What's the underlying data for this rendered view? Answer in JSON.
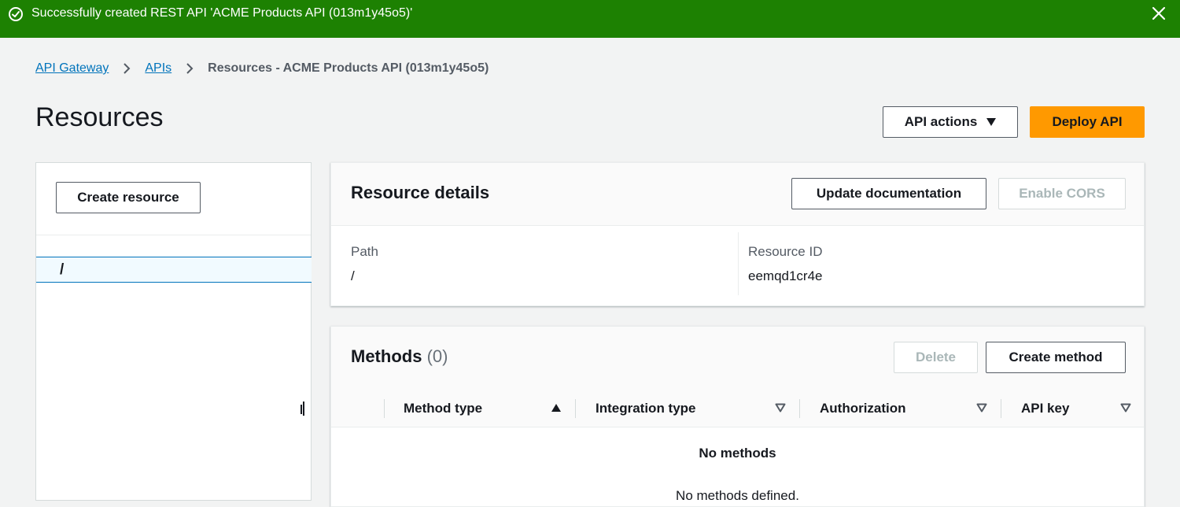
{
  "flash": {
    "message": "Successfully created REST API 'ACME Products API (013m1y45o5)'",
    "icon": "check-circle-icon",
    "close_icon": "close-icon",
    "color": "#1d8102"
  },
  "breadcrumb": {
    "items": [
      {
        "label": "API Gateway"
      },
      {
        "label": "APIs"
      }
    ],
    "current": "Resources - ACME Products API (013m1y45o5)"
  },
  "header": {
    "title": "Resources",
    "api_actions_label": "API actions",
    "deploy_label": "Deploy API",
    "accent": "#ff9900"
  },
  "left_panel": {
    "create_resource_label": "Create resource",
    "tree": [
      {
        "path": "/",
        "selected": true
      }
    ]
  },
  "resource_details": {
    "title": "Resource details",
    "update_doc_label": "Update documentation",
    "enable_cors_label": "Enable CORS",
    "path_label": "Path",
    "path_value": "/",
    "resource_id_label": "Resource ID",
    "resource_id_value": "eemqd1cr4e"
  },
  "methods": {
    "title": "Methods",
    "count": "(0)",
    "delete_label": "Delete",
    "create_label": "Create method",
    "columns": [
      {
        "label": "Method type",
        "sort": "ascending"
      },
      {
        "label": "Integration type",
        "sort": "none"
      },
      {
        "label": "Authorization",
        "sort": "none"
      },
      {
        "label": "API key",
        "sort": "none"
      }
    ],
    "empty_title": "No methods",
    "empty_subtitle": "No methods defined."
  }
}
